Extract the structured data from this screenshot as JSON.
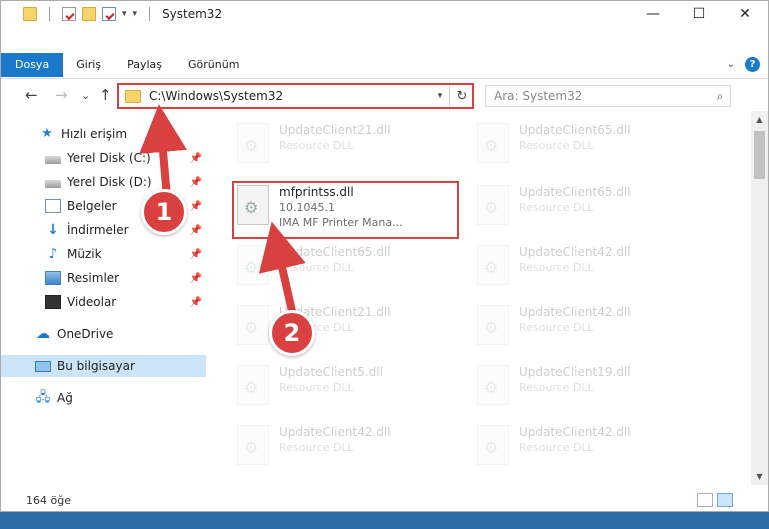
{
  "window": {
    "title": "System32",
    "controls": {
      "minimize": "—",
      "maximize": "☐",
      "close": "✕"
    }
  },
  "ribbon": {
    "tabs": [
      "Dosya",
      "Giriş",
      "Paylaş",
      "Görünüm"
    ],
    "help": "?"
  },
  "nav": {
    "back": "←",
    "forward": "→",
    "recent": "⌄",
    "up": "↑",
    "address": "C:\\Windows\\System32",
    "refresh": "↻",
    "search_placeholder": "Ara: System32"
  },
  "sidebar": {
    "items": [
      {
        "label": "Hızlı erişim",
        "icon": "star-icon"
      },
      {
        "label": "Yerel Disk (C:)",
        "icon": "disk-icon",
        "pinned": true
      },
      {
        "label": "Yerel Disk (D:)",
        "icon": "disk-icon",
        "pinned": true
      },
      {
        "label": "Belgeler",
        "icon": "document-icon",
        "pinned": true
      },
      {
        "label": "İndirmeler",
        "icon": "download-icon",
        "pinned": true
      },
      {
        "label": "Müzik",
        "icon": "music-icon",
        "pinned": true
      },
      {
        "label": "Resimler",
        "icon": "pictures-icon",
        "pinned": true
      },
      {
        "label": "Videolar",
        "icon": "video-icon",
        "pinned": true
      },
      {
        "label": "OneDrive",
        "icon": "cloud-icon"
      },
      {
        "label": "Bu bilgisayar",
        "icon": "computer-icon",
        "selected": true
      },
      {
        "label": "Ağ",
        "icon": "network-icon"
      }
    ]
  },
  "files": [
    {
      "name": "UpdateClient21.dll",
      "line2": "Resource DLL",
      "faded": true
    },
    {
      "name": "UpdateClient65.dll",
      "line2": "Resource DLL",
      "faded": true
    },
    {
      "name": "mfprintss.dll",
      "line2": "10.1045.1",
      "line3": "IMA MF Printer Mana...",
      "faded": false
    },
    {
      "name": "UpdateClient65.dll",
      "line2": "Resource DLL",
      "faded": true
    },
    {
      "name": "UpdateClient65.dll",
      "line2": "Resource DLL",
      "faded": true
    },
    {
      "name": "UpdateClient42.dll",
      "line2": "Resource DLL",
      "faded": true
    },
    {
      "name": "UpdateClient21.dll",
      "line2": "Resource DLL",
      "faded": true
    },
    {
      "name": "UpdateClient42.dll",
      "line2": "Resource DLL",
      "faded": true
    },
    {
      "name": "UpdateClient5.dll",
      "line2": "Resource DLL",
      "faded": true
    },
    {
      "name": "UpdateClient19.dll",
      "line2": "Resource DLL",
      "faded": true
    },
    {
      "name": "UpdateClient42.dll",
      "line2": "Resource DLL",
      "faded": true
    },
    {
      "name": "UpdateClient42.dll",
      "line2": "Resource DLL",
      "faded": true
    }
  ],
  "status": {
    "count": "164 öğe"
  },
  "annotations": {
    "step1": "1",
    "step2": "2",
    "color": "#d94040"
  }
}
